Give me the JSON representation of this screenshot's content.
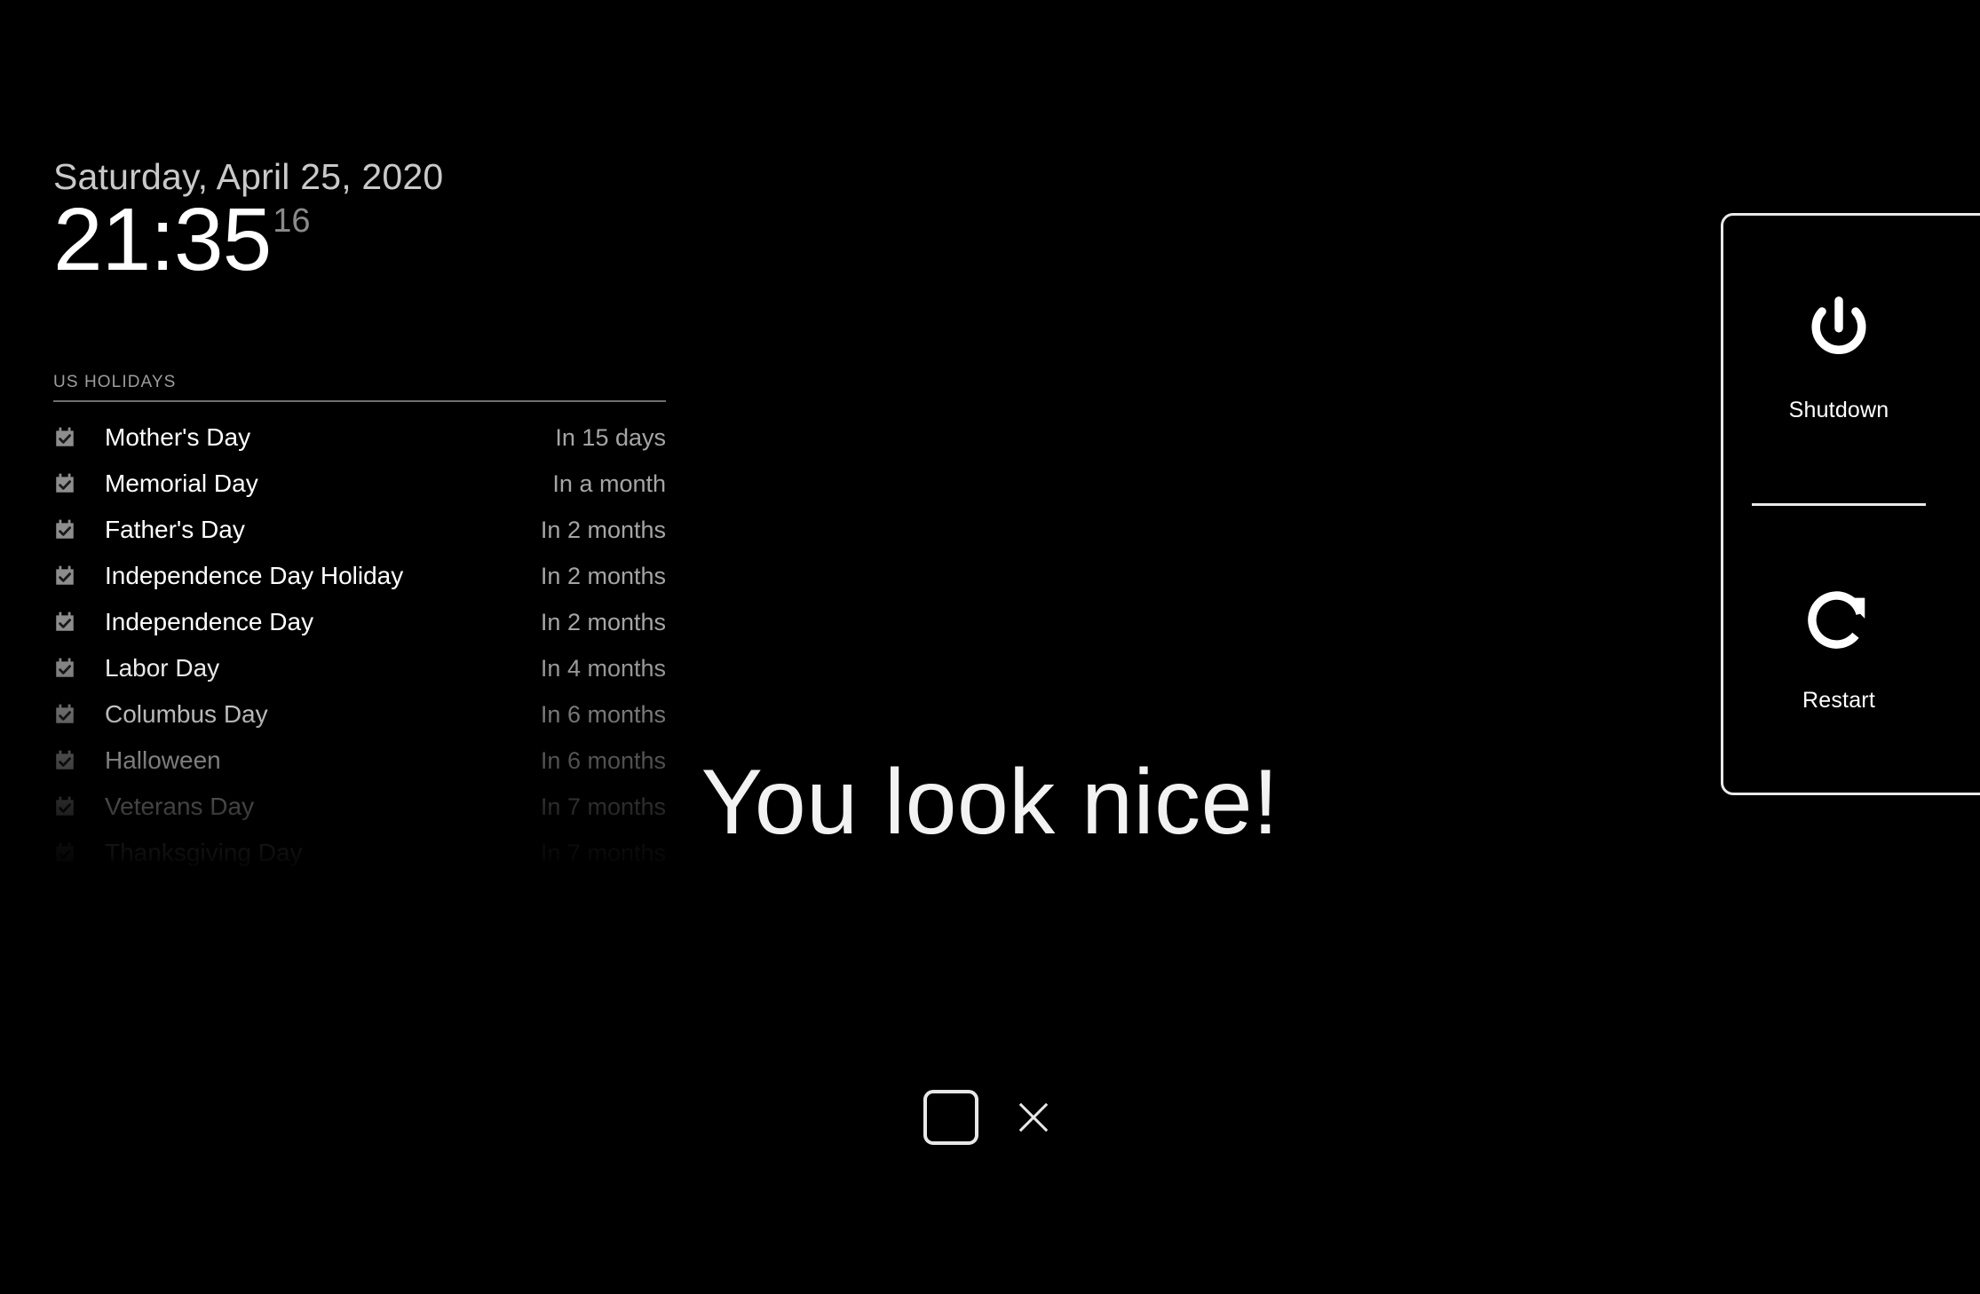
{
  "clock": {
    "date": "Saturday, April 25, 2020",
    "time": "21:35",
    "seconds": "16"
  },
  "holidays": {
    "title": "US Holidays",
    "icon": "calendar-check-icon",
    "items": [
      {
        "name": "Mother's Day",
        "when": "In 15 days"
      },
      {
        "name": "Memorial Day",
        "when": "In a month"
      },
      {
        "name": "Father's Day",
        "when": "In 2 months"
      },
      {
        "name": "Independence Day Holiday",
        "when": "In 2 months"
      },
      {
        "name": "Independence Day",
        "when": "In 2 months"
      },
      {
        "name": "Labor Day",
        "when": "In 4 months"
      },
      {
        "name": "Columbus Day",
        "when": "In 6 months"
      },
      {
        "name": "Halloween",
        "when": "In 6 months"
      },
      {
        "name": "Veterans Day",
        "when": "In 7 months"
      },
      {
        "name": "Thanksgiving Day",
        "when": "In 7 months"
      }
    ]
  },
  "greeting": {
    "message": "You look nice!"
  },
  "window_controls": {
    "maximize_icon": "rounded-square-icon",
    "close_icon": "close-x-icon"
  },
  "power_panel": {
    "shutdown": {
      "label": "Shutdown",
      "icon": "power-icon"
    },
    "restart": {
      "label": "Restart",
      "icon": "refresh-clockwise-icon"
    }
  },
  "colors": {
    "background": "#000000",
    "primary_text": "#ffffff",
    "secondary_text": "#a5a5a5",
    "muted_text": "#9d9d9d",
    "date_text": "#c9c9c9",
    "seconds_text": "#8a8a8a",
    "rule": "#6e6e6e",
    "panel_border": "#e9e9e9"
  }
}
